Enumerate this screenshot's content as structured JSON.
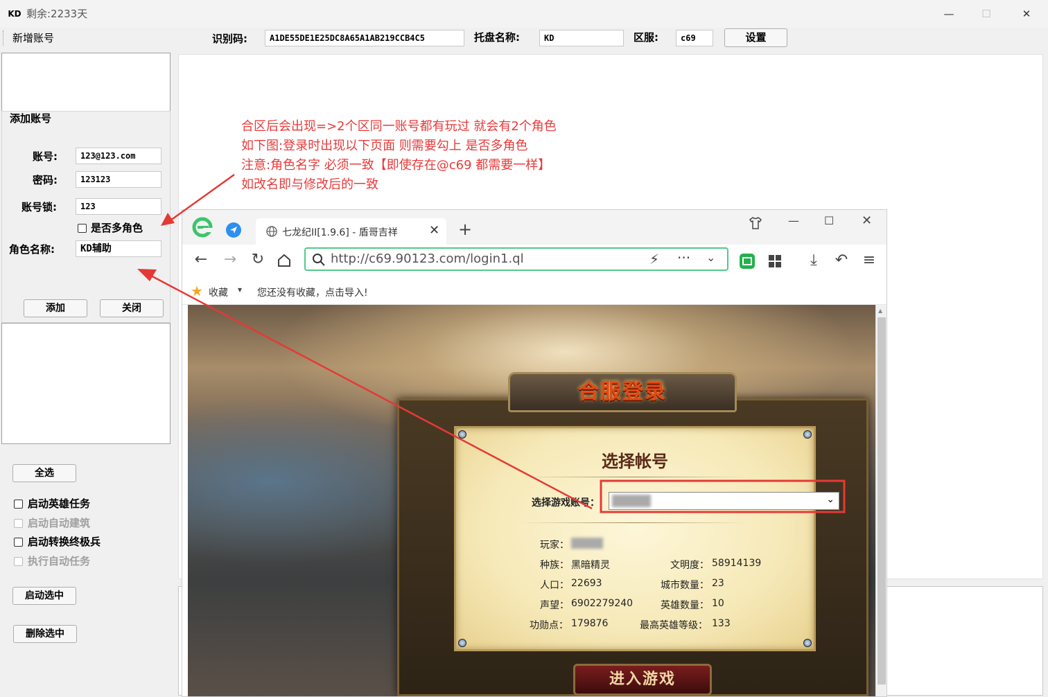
{
  "window": {
    "app_icon_text": "KD",
    "title": "剩余:2233天",
    "minimize_glyph": "—",
    "maximize_glyph": "☐",
    "close_glyph": "✕"
  },
  "toolbar": {
    "new_account_label": "新增账号",
    "id_code_label": "识别码:",
    "id_code_value": "A1DE55DE1E25DC8A65A1AB219CCB4C5",
    "host_name_label": "托盘名称:",
    "host_name_value": "KD",
    "server_label": "区服:",
    "server_value": "c69",
    "settings_button": "设置"
  },
  "add_account": {
    "group_title": "添加账号",
    "account_label": "账号:",
    "account_value": "123@123.com",
    "password_label": "密码:",
    "password_value": "123123",
    "lock_label": "账号锁:",
    "lock_value": "123",
    "multi_role_label": "是否多角色",
    "role_name_label": "角色名称:",
    "role_name_value": "KD辅助",
    "add_button": "添加",
    "close_button": "关闭"
  },
  "controls": {
    "select_all_button": "全选",
    "options": [
      {
        "label": "启动英雄任务",
        "enabled": true
      },
      {
        "label": "启动自动建筑",
        "enabled": false
      },
      {
        "label": "启动转换终极兵",
        "enabled": true
      },
      {
        "label": "执行自动任务",
        "enabled": false
      }
    ],
    "start_selected_button": "启动选中",
    "delete_selected_button": "删除选中"
  },
  "annotation": {
    "lines": [
      "合区后会出现=>2个区同一账号都有玩过 就会有2个角色",
      "如下图:登录时出现以下页面 则需要勾上 是否多角色",
      "注意:角色名字 必须一致【即使存在@c69 都需要一样】",
      "如改名即与修改后的一致"
    ],
    "color": "#e83a3a"
  },
  "browser": {
    "tab_title": "七龙纪II[1.9.6] - 盾哥吉祥",
    "url": "http://c69.90123.com/login1.ql",
    "bookmarks_label": "收藏",
    "bookmarks_hint": "您还没有收藏，点击导入!",
    "icons": [
      "browser-logo-icon",
      "send-icon",
      "globe-icon",
      "close-icon",
      "plus-icon",
      "shirt-icon",
      "back-icon",
      "forward-icon",
      "refresh-icon",
      "home-icon",
      "search-icon",
      "lightning-icon",
      "more-icon",
      "chevron-down-icon",
      "extension-icon",
      "apps-icon",
      "download-icon",
      "undo-icon",
      "menu-icon",
      "star-icon"
    ]
  },
  "game": {
    "banner": "合服登录",
    "panel_title": "选择帐号",
    "select_label": "选择游戏账号：",
    "select_value": "",
    "player_label": "玩家：",
    "race_label": "种族：",
    "race_value": "黑暗精灵",
    "civ_label": "文明度：",
    "civ_value": "58914139",
    "pop_label": "人口：",
    "pop_value": "22693",
    "cities_label": "城市数量：",
    "cities_value": "23",
    "fame_label": "声望：",
    "fame_value": "6902279240",
    "heroes_label": "英雄数量：",
    "heroes_value": "10",
    "merit_label": "功勋点：",
    "merit_value": "179876",
    "max_hero_label": "最高英雄等级：",
    "max_hero_value": "133",
    "enter_button": "进入游戏"
  }
}
